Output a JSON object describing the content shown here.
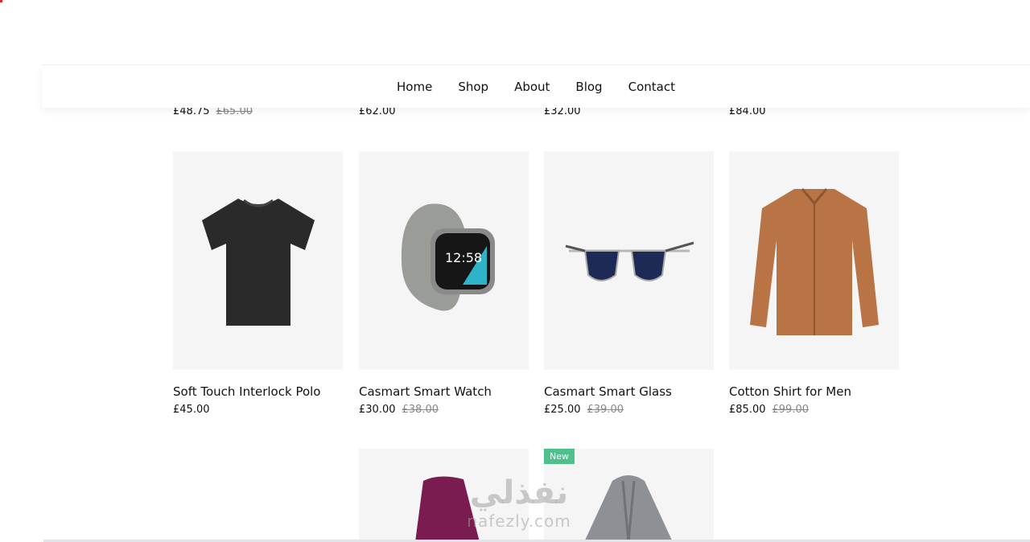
{
  "nav": {
    "items": [
      {
        "label": "Home"
      },
      {
        "label": "Shop"
      },
      {
        "label": "About"
      },
      {
        "label": "Blog"
      },
      {
        "label": "Contact"
      }
    ]
  },
  "top_row_prices": [
    {
      "price": "£48.75",
      "old_price": "£65.00"
    },
    {
      "price": "£62.00",
      "old_price": ""
    },
    {
      "price": "£32.00",
      "old_price": ""
    },
    {
      "price": "£84.00",
      "old_price": ""
    }
  ],
  "products": [
    {
      "name": "Soft Touch Interlock Polo",
      "price": "£45.00",
      "old_price": "",
      "icon": "tshirt-icon"
    },
    {
      "name": "Casmart Smart Watch",
      "price": "£30.00",
      "old_price": "£38.00",
      "icon": "smartwatch-icon"
    },
    {
      "name": "Casmart Smart Glass",
      "price": "£25.00",
      "old_price": "£39.00",
      "icon": "sunglasses-icon"
    },
    {
      "name": "Cotton Shirt for Men",
      "price": "£85.00",
      "old_price": "£99.00",
      "icon": "shirt-icon"
    }
  ],
  "bottom_row": {
    "badge": "New",
    "items": [
      {
        "icon": "hoodie-icon"
      },
      {
        "icon": "cardigan-icon"
      }
    ]
  },
  "watermark": {
    "arabic": "نفذلي",
    "latin": "nafezly.com"
  }
}
